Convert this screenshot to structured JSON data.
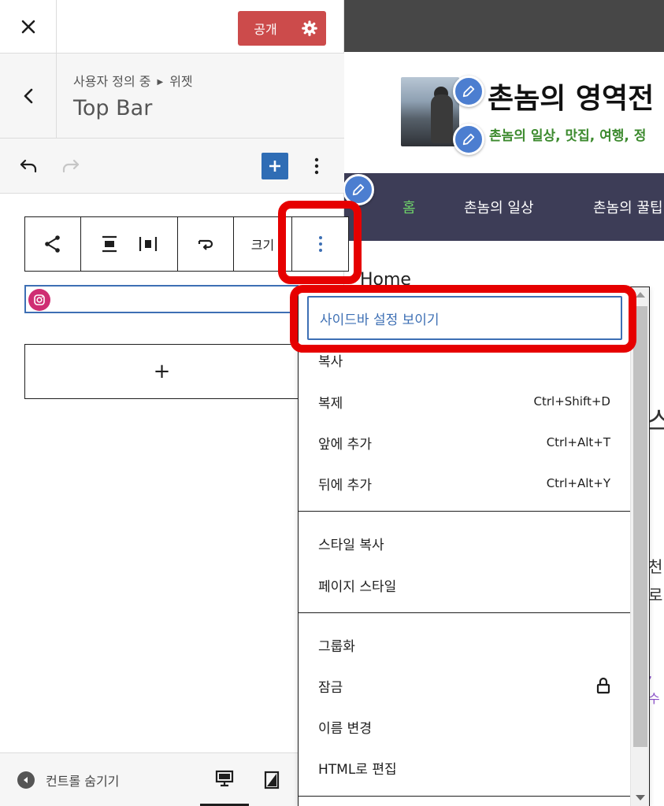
{
  "sidebar": {
    "publish_label": "공개",
    "breadcrumb_root": "사용자 정의 중",
    "breadcrumb_section": "위젯",
    "panel_title": "Top Bar",
    "block_toolbar": {
      "size_label": "크기"
    },
    "add_widget_symbol": "+",
    "footer": {
      "hide_controls_label": "컨트롤 숨기기"
    }
  },
  "preview": {
    "site_title": "촌놈의 영역전",
    "site_tagline": "촌놈의 일상, 맛집, 여행, 정",
    "nav": [
      "홈",
      "촌놈의 일상",
      "촌놈의 꿀팁"
    ],
    "breadcrumb": "Home",
    "fragments": [
      "스",
      "천",
      "로",
      ", ",
      "수"
    ]
  },
  "menu": {
    "items": [
      {
        "label": "사이드바 설정 보이기",
        "shortcut": ""
      },
      {
        "label": "복사",
        "shortcut": ""
      },
      {
        "label": "복제",
        "shortcut": "Ctrl+Shift+D"
      },
      {
        "label": "앞에 추가",
        "shortcut": "Ctrl+Alt+T"
      },
      {
        "label": "뒤에 추가",
        "shortcut": "Ctrl+Alt+Y"
      },
      {
        "label": "스타일 복사",
        "shortcut": ""
      },
      {
        "label": "페이지 스타일",
        "shortcut": ""
      },
      {
        "label": "그룹화",
        "shortcut": ""
      },
      {
        "label": "잠금",
        "shortcut": ""
      },
      {
        "label": "이름 변경",
        "shortcut": ""
      },
      {
        "label": "HTML로 편집",
        "shortcut": ""
      }
    ]
  },
  "colors": {
    "publish": "#cc4b4b",
    "accent": "#3d6fb4",
    "annotation": "#e60000",
    "nav_bg": "#3d3d57",
    "nav_active": "#6fd36a",
    "tagline": "#3c8a2e"
  }
}
